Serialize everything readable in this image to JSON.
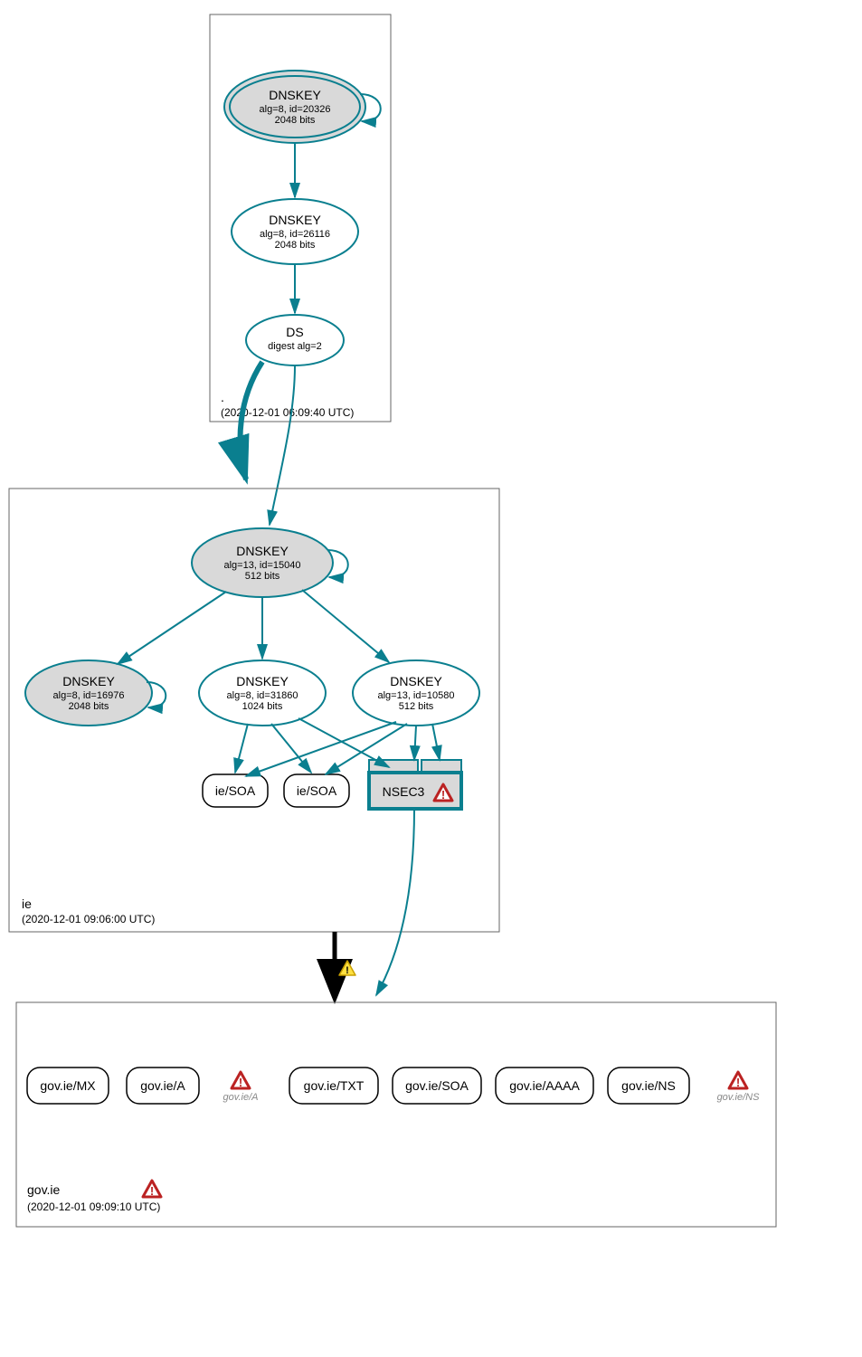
{
  "zones": {
    "root": {
      "label": ".",
      "timestamp": "(2020-12-01 06:09:40 UTC)"
    },
    "ie": {
      "label": "ie",
      "timestamp": "(2020-12-01 09:06:00 UTC)"
    },
    "gov": {
      "label": "gov.ie",
      "timestamp": "(2020-12-01 09:09:10 UTC)"
    }
  },
  "nodes": {
    "root_ksk": {
      "title": "DNSKEY",
      "line1": "alg=8, id=20326",
      "line2": "2048 bits"
    },
    "root_zsk": {
      "title": "DNSKEY",
      "line1": "alg=8, id=26116",
      "line2": "2048 bits"
    },
    "root_ds": {
      "title": "DS",
      "line1": "digest alg=2"
    },
    "ie_ksk": {
      "title": "DNSKEY",
      "line1": "alg=13, id=15040",
      "line2": "512 bits"
    },
    "ie_key1": {
      "title": "DNSKEY",
      "line1": "alg=8, id=16976",
      "line2": "2048 bits"
    },
    "ie_key2": {
      "title": "DNSKEY",
      "line1": "alg=8, id=31860",
      "line2": "1024 bits"
    },
    "ie_key3": {
      "title": "DNSKEY",
      "line1": "alg=13, id=10580",
      "line2": "512 bits"
    },
    "ie_soa1": {
      "label": "ie/SOA"
    },
    "ie_soa2": {
      "label": "ie/SOA"
    },
    "nsec3": {
      "label": "NSEC3"
    }
  },
  "rrsets": {
    "mx": {
      "label": "gov.ie/MX"
    },
    "a": {
      "label": "gov.ie/A"
    },
    "txt": {
      "label": "gov.ie/TXT"
    },
    "soa": {
      "label": "gov.ie/SOA"
    },
    "aaaa": {
      "label": "gov.ie/AAAA"
    },
    "ns": {
      "label": "gov.ie/NS"
    }
  },
  "errors": {
    "a": "gov.ie/A",
    "ns": "gov.ie/NS"
  }
}
